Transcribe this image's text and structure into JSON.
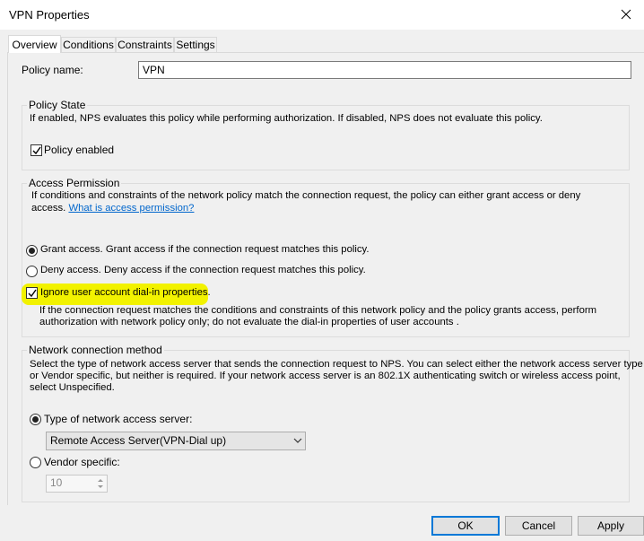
{
  "window": {
    "title": "VPN Properties"
  },
  "tabs": [
    {
      "label": "Overview",
      "active": true
    },
    {
      "label": "Conditions",
      "active": false
    },
    {
      "label": "Constraints",
      "active": false
    },
    {
      "label": "Settings",
      "active": false
    }
  ],
  "policy": {
    "name_label": "Policy name:",
    "name_value": "VPN"
  },
  "policy_state": {
    "legend": "Policy State",
    "description": "If enabled, NPS evaluates this policy while performing authorization. If disabled, NPS does not evaluate this policy.",
    "enabled_label": "Policy enabled",
    "enabled": true
  },
  "access_permission": {
    "legend": "Access Permission",
    "description_line1": "If conditions and constraints of the network policy match the connection request, the policy can either grant access or deny",
    "description_line2": "access.",
    "link": "What is access permission?",
    "grant_label": "Grant access. Grant access if the connection request matches this policy.",
    "deny_label": "Deny access. Deny access if the connection request matches this policy.",
    "ignore_label": "Ignore user account dial-in properties.",
    "ignore_desc_line1": "If the connection request matches the conditions and constraints of this network policy and the policy grants access, perform",
    "ignore_desc_line2": "authorization with network policy only; do not evaluate the dial-in properties of user accounts ."
  },
  "network_method": {
    "legend": "Network connection method",
    "desc_line1": "Select the type of network access server that sends the connection request to NPS. You can select either the network access server type",
    "desc_line2": "or Vendor specific, but neither is required.  If your network access server is an 802.1X authenticating switch or wireless access point,",
    "desc_line3": "select Unspecified.",
    "type_label": "Type of network access server:",
    "type_selected": "Remote Access Server(VPN-Dial up)",
    "vendor_label": "Vendor specific:",
    "vendor_value": "10"
  },
  "buttons": {
    "ok": "OK",
    "cancel": "Cancel",
    "apply": "Apply"
  },
  "colors": {
    "accent": "#0078d7",
    "highlight": "#f2f200",
    "link": "#0066cc"
  }
}
